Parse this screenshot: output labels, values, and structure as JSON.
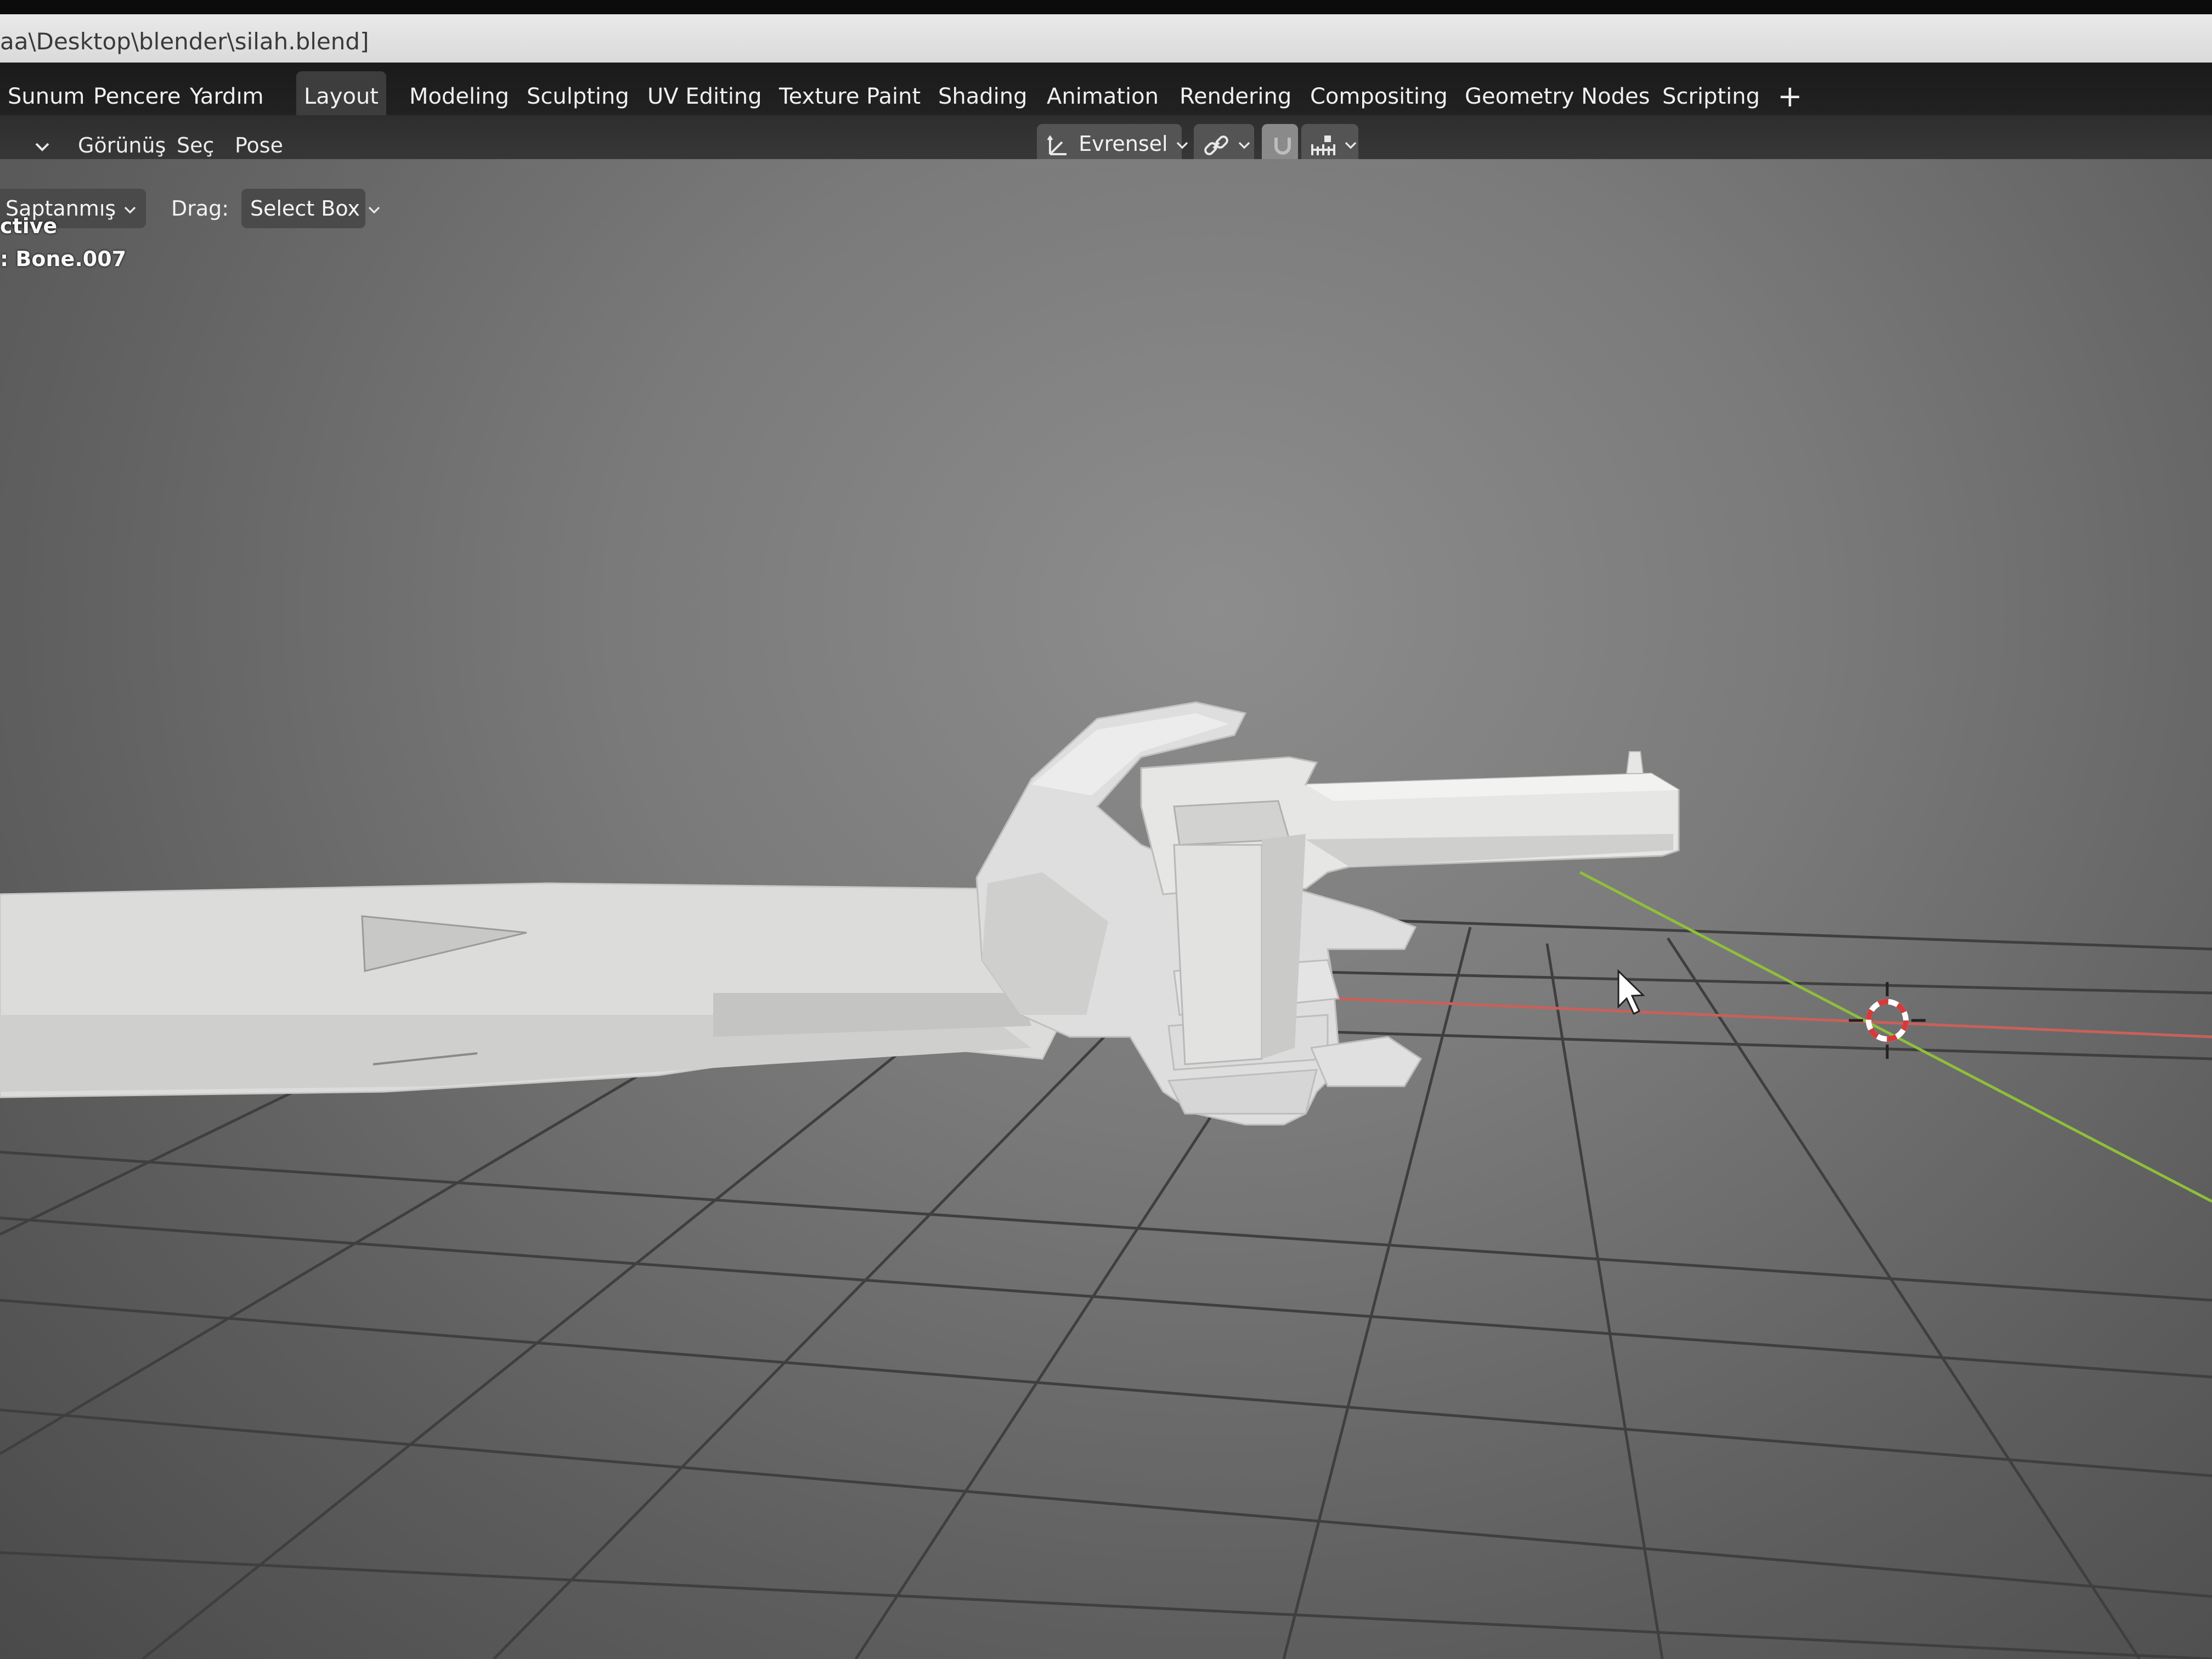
{
  "titlebar": {
    "path": "aa\\Desktop\\blender\\silah.blend]"
  },
  "menu": [
    {
      "id": "sunum",
      "label": "Sunum"
    },
    {
      "id": "pencere",
      "label": "Pencere"
    },
    {
      "id": "yardim",
      "label": "Yardım"
    }
  ],
  "workspaces": [
    {
      "id": "layout",
      "label": "Layout",
      "active": true
    },
    {
      "id": "modeling",
      "label": "Modeling"
    },
    {
      "id": "sculpting",
      "label": "Sculpting"
    },
    {
      "id": "uv-editing",
      "label": "UV Editing"
    },
    {
      "id": "texture-paint",
      "label": "Texture Paint"
    },
    {
      "id": "shading",
      "label": "Shading"
    },
    {
      "id": "animation",
      "label": "Animation"
    },
    {
      "id": "rendering",
      "label": "Rendering"
    },
    {
      "id": "compositing",
      "label": "Compositing"
    },
    {
      "id": "geometry-nodes",
      "label": "Geometry Nodes"
    },
    {
      "id": "scripting",
      "label": "Scripting"
    }
  ],
  "workspace_add": "+",
  "header": {
    "gorunus": "Görünüş",
    "sec": "Seç",
    "pose": "Pose",
    "transform_orientation": "Evrensel"
  },
  "toolsettings": {
    "pivot_label": "Saptanmış",
    "drag_label": "Drag:",
    "drag_value": "Select Box"
  },
  "overlay": {
    "mode": "ctive",
    "bone": ": Bone.007"
  },
  "colors": {
    "x_axis": "#c9605a",
    "y_axis": "#8fbf3a",
    "model": "#dcdcda",
    "cursor_red": "#d63a3a"
  }
}
